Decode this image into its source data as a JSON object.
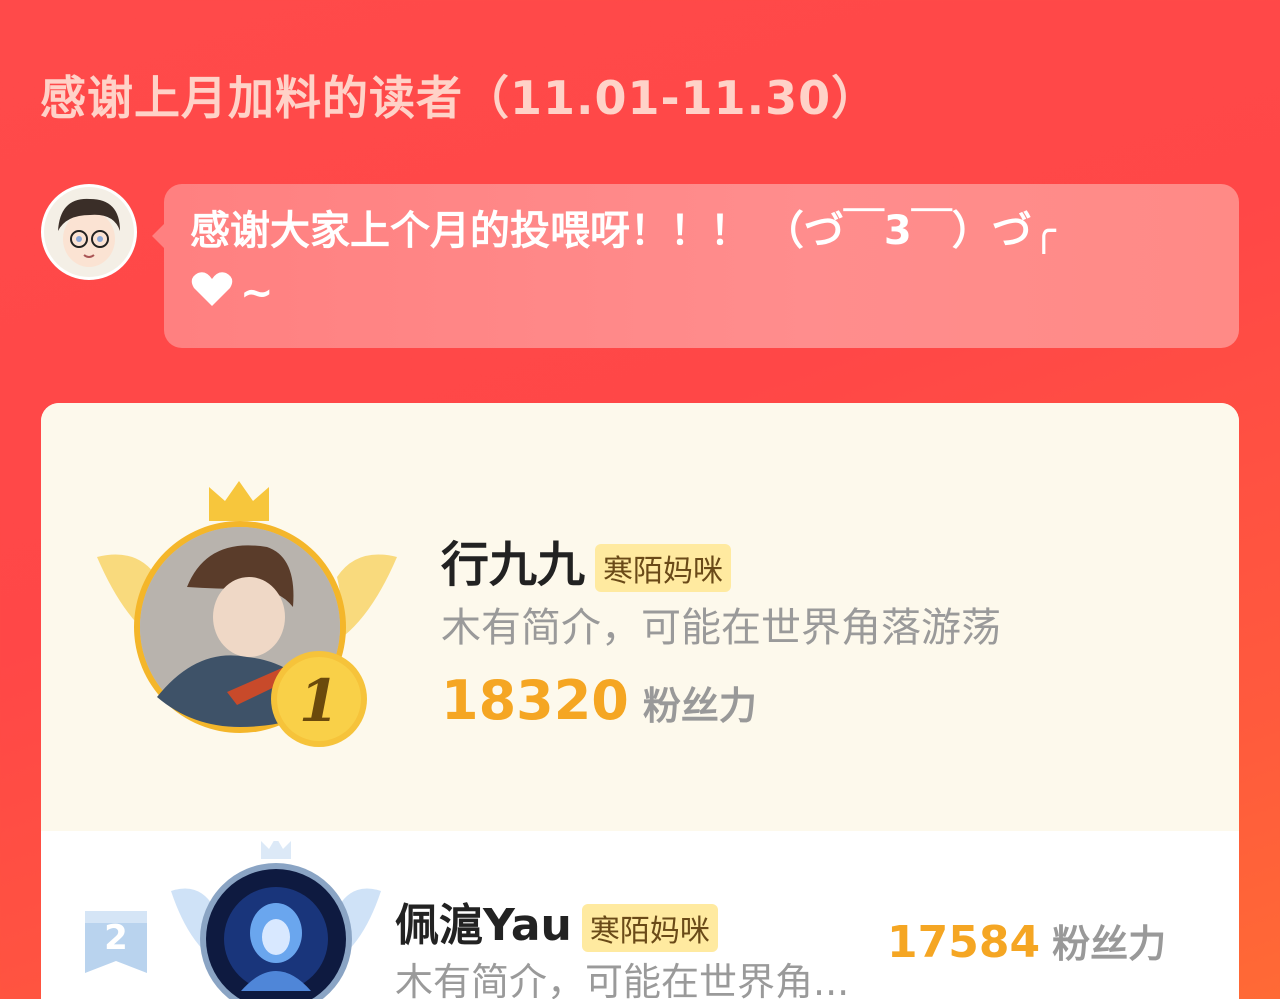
{
  "header": {
    "title": "感谢上月加料的读者（11.01-11.30）"
  },
  "author_message": {
    "text": "感谢大家上个月的投喂呀！！！ （づ￣3￣）づ╭",
    "tail": "~"
  },
  "ranking": [
    {
      "rank": "1",
      "name": "行九九",
      "tag": "寒陌妈咪",
      "bio": "木有简介，可能在世界角落游荡",
      "fans": "18320",
      "fans_unit": "粉丝力"
    },
    {
      "rank": "2",
      "name": "佩滬Yau",
      "tag": "寒陌妈咪",
      "bio": "木有简介，可能在世界角...",
      "fans": "17584",
      "fans_unit": "粉丝力"
    }
  ],
  "colors": {
    "background": "#ff4a4a",
    "fans_number": "#f5a623",
    "tag_bg": "#ffeaa0"
  }
}
